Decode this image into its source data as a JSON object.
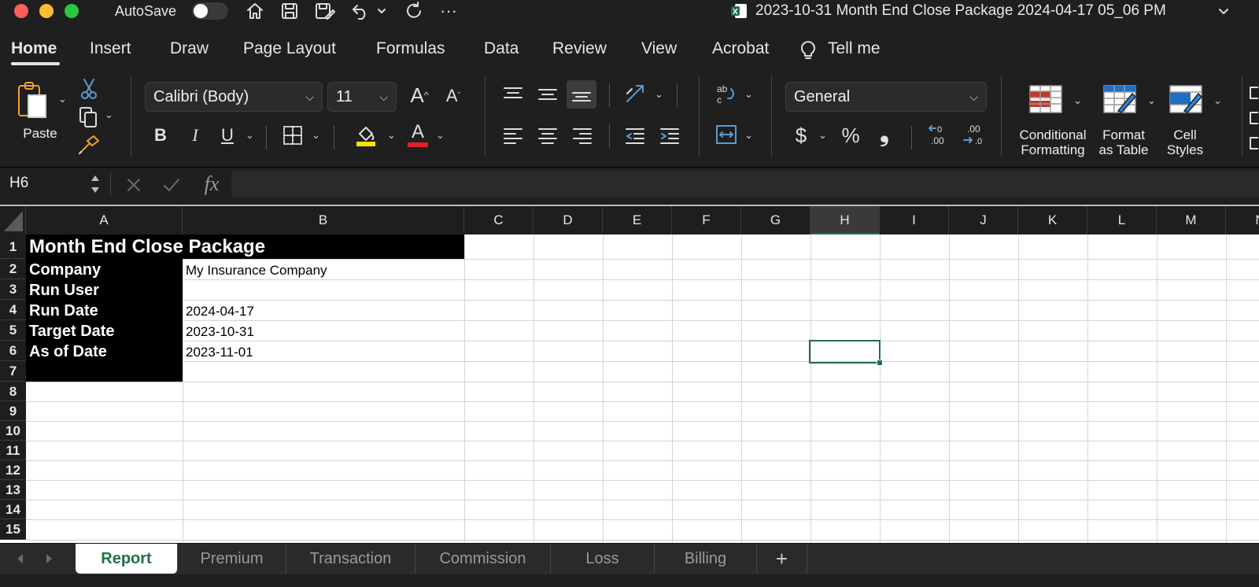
{
  "titlebar": {
    "autosave_label": "AutoSave",
    "document_title": "2023-10-31 Month End Close Package 2024-04-17 05_06 PM",
    "more": "···"
  },
  "ribbon_tabs": [
    "Home",
    "Insert",
    "Draw",
    "Page Layout",
    "Formulas",
    "Data",
    "Review",
    "View",
    "Acrobat",
    "Tell me"
  ],
  "active_tab": "Home",
  "ribbon": {
    "paste_label": "Paste",
    "font_name": "Calibri (Body)",
    "font_size": "11",
    "bold": "B",
    "italic": "I",
    "underline": "U",
    "font_color_letter": "A",
    "number_format": "General",
    "currency": "$",
    "percent": "%",
    "comma": "❟",
    "conditional_formatting": [
      "Conditional",
      "Formatting"
    ],
    "format_as_table": [
      "Format",
      "as Table"
    ],
    "cell_styles": [
      "Cell",
      "Styles"
    ],
    "colors": {
      "highlight": "#f5e500",
      "font_color": "#e0202a"
    }
  },
  "formula_bar": {
    "name_box": "H6",
    "fx": "fx",
    "content": ""
  },
  "grid": {
    "columns": [
      "A",
      "B",
      "C",
      "D",
      "E",
      "F",
      "G",
      "H",
      "I",
      "J",
      "K",
      "L",
      "M",
      "N"
    ],
    "rows": [
      "1",
      "2",
      "3",
      "4",
      "5",
      "6",
      "7",
      "8",
      "9",
      "10",
      "11",
      "12",
      "13",
      "14",
      "15"
    ],
    "selected_column": "H",
    "selected_cell": "H6",
    "cells": {
      "A1": "Month End Close Package",
      "A2": "Company",
      "B2": "My Insurance Company",
      "A3": "Run User",
      "A4": "Run Date",
      "B4": "2024-04-17",
      "A5": "Target Date",
      "B5": "2023-10-31",
      "A6": "As of Date",
      "B6": "2023-11-01"
    }
  },
  "sheet_tabs": [
    "Report",
    "Premium",
    "Transaction",
    "Commission",
    "Loss",
    "Billing"
  ],
  "active_sheet": "Report",
  "add_sheet": "+"
}
